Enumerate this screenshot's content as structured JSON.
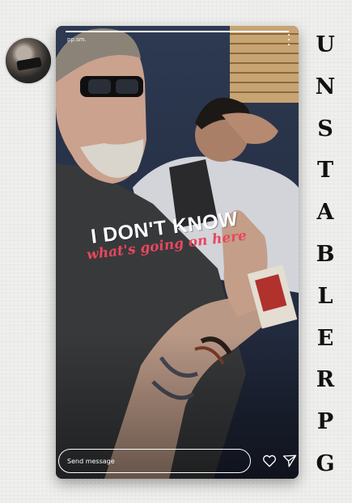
{
  "profile": {
    "avatar_icon": "profile-avatar"
  },
  "story": {
    "username": "pp.sm.",
    "progress": 1.0,
    "headline_line1": "I DON'T KNOW",
    "headline_line2": "what's going on here",
    "headline_line2_color": "#e8475e"
  },
  "reply": {
    "placeholder": "Send message",
    "like_icon": "heart-icon",
    "share_icon": "paper-plane-icon"
  },
  "brand": {
    "letters": [
      "U",
      "N",
      "S",
      "T",
      "A",
      "B",
      "L",
      "E",
      "R",
      "P",
      "G"
    ]
  }
}
